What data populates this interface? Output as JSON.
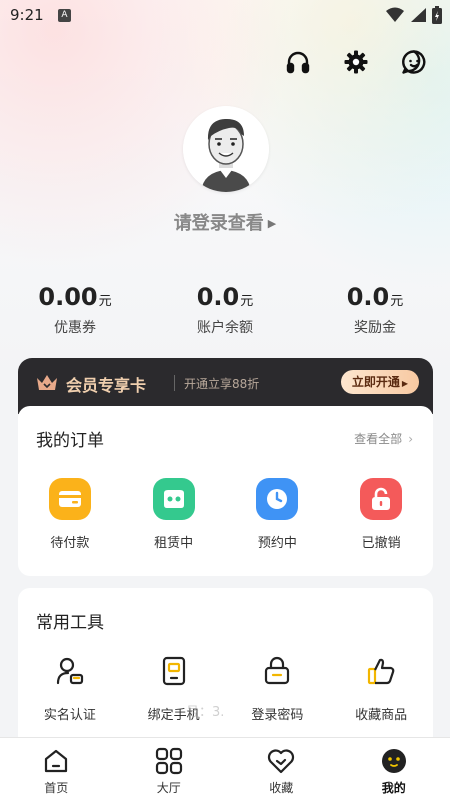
{
  "status_bar": {
    "time": "9:21",
    "indicator": "A"
  },
  "header": {
    "icons": [
      "headset-icon",
      "gear-icon",
      "chat-icon"
    ]
  },
  "profile": {
    "login_prompt": "请登录查看"
  },
  "stats": [
    {
      "value": "0.00",
      "unit": "元",
      "label": "优惠券"
    },
    {
      "value": "0.0",
      "unit": "元",
      "label": "账户余额"
    },
    {
      "value": "0.0",
      "unit": "元",
      "label": "奖励金"
    }
  ],
  "vip": {
    "title": "会员专享卡",
    "subtitle": "开通立享88折",
    "button": "立即开通",
    "colors": {
      "bg": "#2b2a2d",
      "title": "#f0cfae"
    }
  },
  "orders": {
    "title": "我的订单",
    "view_all": "查看全部",
    "items": [
      {
        "label": "待付款",
        "icon": "wallet-icon",
        "color": "#fbb21a"
      },
      {
        "label": "租赁中",
        "icon": "gamepad-icon",
        "color": "#34c98e"
      },
      {
        "label": "预约中",
        "icon": "clock-icon",
        "color": "#3f93f5"
      },
      {
        "label": "已撤销",
        "icon": "unlock-icon",
        "color": "#f45a5a"
      }
    ]
  },
  "tools": {
    "title": "常用工具",
    "items": [
      {
        "label": "实名认证",
        "icon": "id-verify-icon"
      },
      {
        "label": "绑定手机",
        "icon": "phone-icon"
      },
      {
        "label": "登录密码",
        "icon": "lock-icon"
      },
      {
        "label": "收藏商品",
        "icon": "thumbs-up-icon"
      }
    ],
    "overlay": "号：3."
  },
  "bottom_nav": [
    {
      "label": "首页",
      "icon": "home-icon"
    },
    {
      "label": "大厅",
      "icon": "grid-icon"
    },
    {
      "label": "收藏",
      "icon": "heart-icon"
    },
    {
      "label": "我的",
      "icon": "profile-face-icon",
      "active": true
    }
  ]
}
